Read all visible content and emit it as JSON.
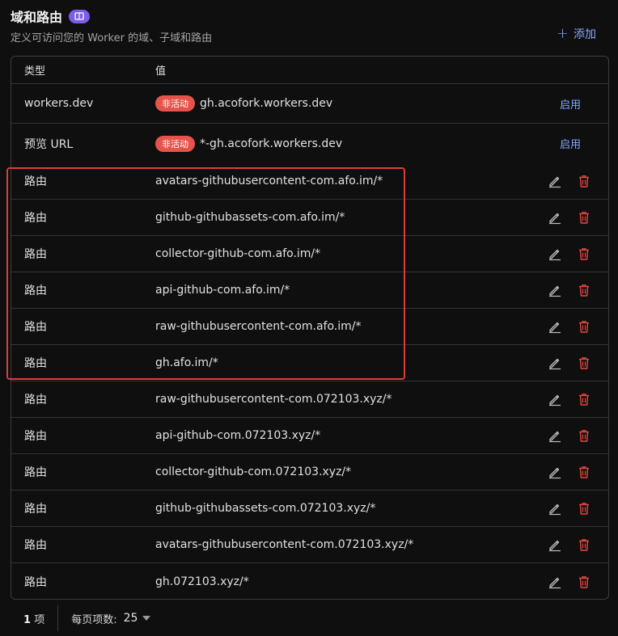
{
  "header": {
    "title": "域和路由",
    "subtitle": "定义可访问您的 Worker 的域、子域和路由",
    "add_label": "添加"
  },
  "table": {
    "columns": {
      "type": "类型",
      "value": "值"
    },
    "domain_rows": [
      {
        "type": "workers.dev",
        "status": "非活动",
        "value": "gh.acofork.workers.dev",
        "action": "启用"
      },
      {
        "type": "预览 URL",
        "status": "非活动",
        "value": "*-gh.acofork.workers.dev",
        "action": "启用"
      }
    ],
    "route_rows": [
      {
        "type": "路由",
        "value": "avatars-githubusercontent-com.afo.im/*"
      },
      {
        "type": "路由",
        "value": "github-githubassets-com.afo.im/*"
      },
      {
        "type": "路由",
        "value": "collector-github-com.afo.im/*"
      },
      {
        "type": "路由",
        "value": "api-github-com.afo.im/*"
      },
      {
        "type": "路由",
        "value": "raw-githubusercontent-com.afo.im/*"
      },
      {
        "type": "路由",
        "value": "gh.afo.im/*"
      },
      {
        "type": "路由",
        "value": "raw-githubusercontent-com.072103.xyz/*"
      },
      {
        "type": "路由",
        "value": "api-github-com.072103.xyz/*"
      },
      {
        "type": "路由",
        "value": "collector-github-com.072103.xyz/*"
      },
      {
        "type": "路由",
        "value": "github-githubassets-com.072103.xyz/*"
      },
      {
        "type": "路由",
        "value": "avatars-githubusercontent-com.072103.xyz/*"
      },
      {
        "type": "路由",
        "value": "gh.072103.xyz/*"
      }
    ]
  },
  "footer": {
    "total_count": "1",
    "total_unit": "项",
    "per_page_label": "每页项数:",
    "per_page_value": "25"
  },
  "colors": {
    "accent": "#82aaff",
    "inactive_badge": "#e5534b",
    "delete_icon": "#e5483f",
    "highlight_box": "#e03b3b",
    "doc_badge": "#7c5ce8"
  }
}
